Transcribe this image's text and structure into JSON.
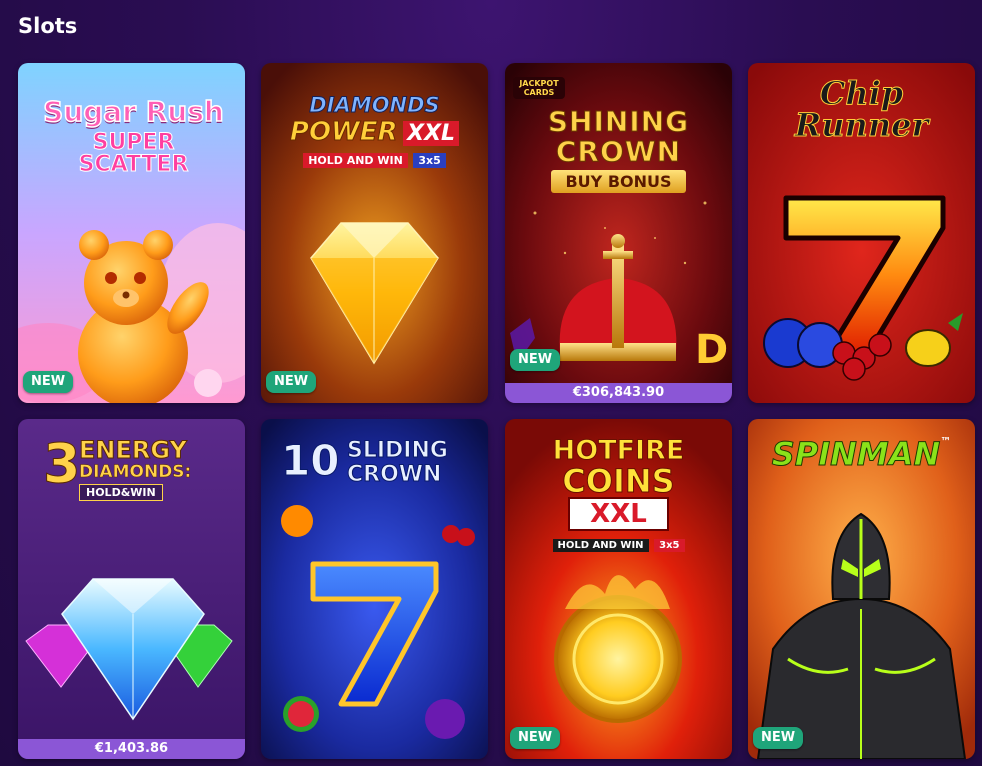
{
  "section": {
    "title": "Slots"
  },
  "games": [
    {
      "name": "Sugar Rush Super Scatter",
      "logo_line1": "Sugar Rush",
      "logo_line2": "SUPER",
      "logo_line3": "SCATTER",
      "badge": "NEW"
    },
    {
      "name": "Diamonds Power XXL",
      "logo_line1": "DIAMONDS",
      "logo_line2": "POWER",
      "logo_line3": "XXL",
      "logo_line4": "HOLD AND WIN",
      "logo_line5": "3x5",
      "badge": "NEW"
    },
    {
      "name": "Shining Crown Buy Bonus",
      "logo_small": "JACKPOT CARDS",
      "logo_line1": "SHINING",
      "logo_line2": "CROWN",
      "logo_line3": "BUY BONUS",
      "badge": "NEW",
      "jackpot": "€306,843.90"
    },
    {
      "name": "Chip Runner",
      "logo_line1": "Chip",
      "logo_line2": "Runner"
    },
    {
      "name": "3 Energy Diamonds: Hold&Win",
      "logo_line1": "3",
      "logo_line2": "ENERGY",
      "logo_line3": "DIAMONDS:",
      "logo_line4": "HOLD&WIN",
      "jackpot": "€1,403.86"
    },
    {
      "name": "10 Sliding Crown",
      "logo_line1": "10",
      "logo_line2": "SLIDING",
      "logo_line3": "CROWN"
    },
    {
      "name": "Hotfire Coins XXL",
      "logo_line1": "HOTFIRE",
      "logo_line2": "COINS",
      "logo_line3": "XXL",
      "logo_line4": "HOLD AND WIN",
      "logo_line5": "3x5",
      "badge": "NEW"
    },
    {
      "name": "Spinman",
      "logo_line1": "SPINMAN",
      "logo_tm": "™",
      "badge": "NEW"
    }
  ],
  "colors": {
    "badge": "#1fa57a",
    "jackpot_bar": "#8b56d6",
    "background": "#2a0d52"
  }
}
